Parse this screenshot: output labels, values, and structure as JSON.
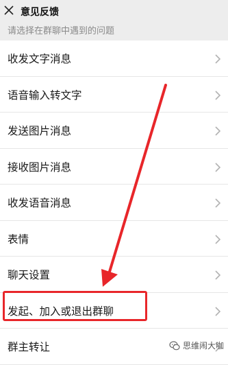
{
  "header": {
    "title": "意见反馈"
  },
  "hint": "请选择在群聊中遇到的问题",
  "items": [
    {
      "label": "收发文字消息"
    },
    {
      "label": "语音输入转文字"
    },
    {
      "label": "发送图片消息"
    },
    {
      "label": "接收图片消息"
    },
    {
      "label": "收发语音消息"
    },
    {
      "label": "表情"
    },
    {
      "label": "聊天设置"
    },
    {
      "label": "发起、加入或退出群聊"
    },
    {
      "label": "群主转让"
    }
  ],
  "watermark": "思维闹大咖",
  "colors": {
    "highlight": "#e8262a",
    "background": "#ededed"
  },
  "icons": {
    "close": "close-icon",
    "chevron": "chevron-right-icon"
  }
}
